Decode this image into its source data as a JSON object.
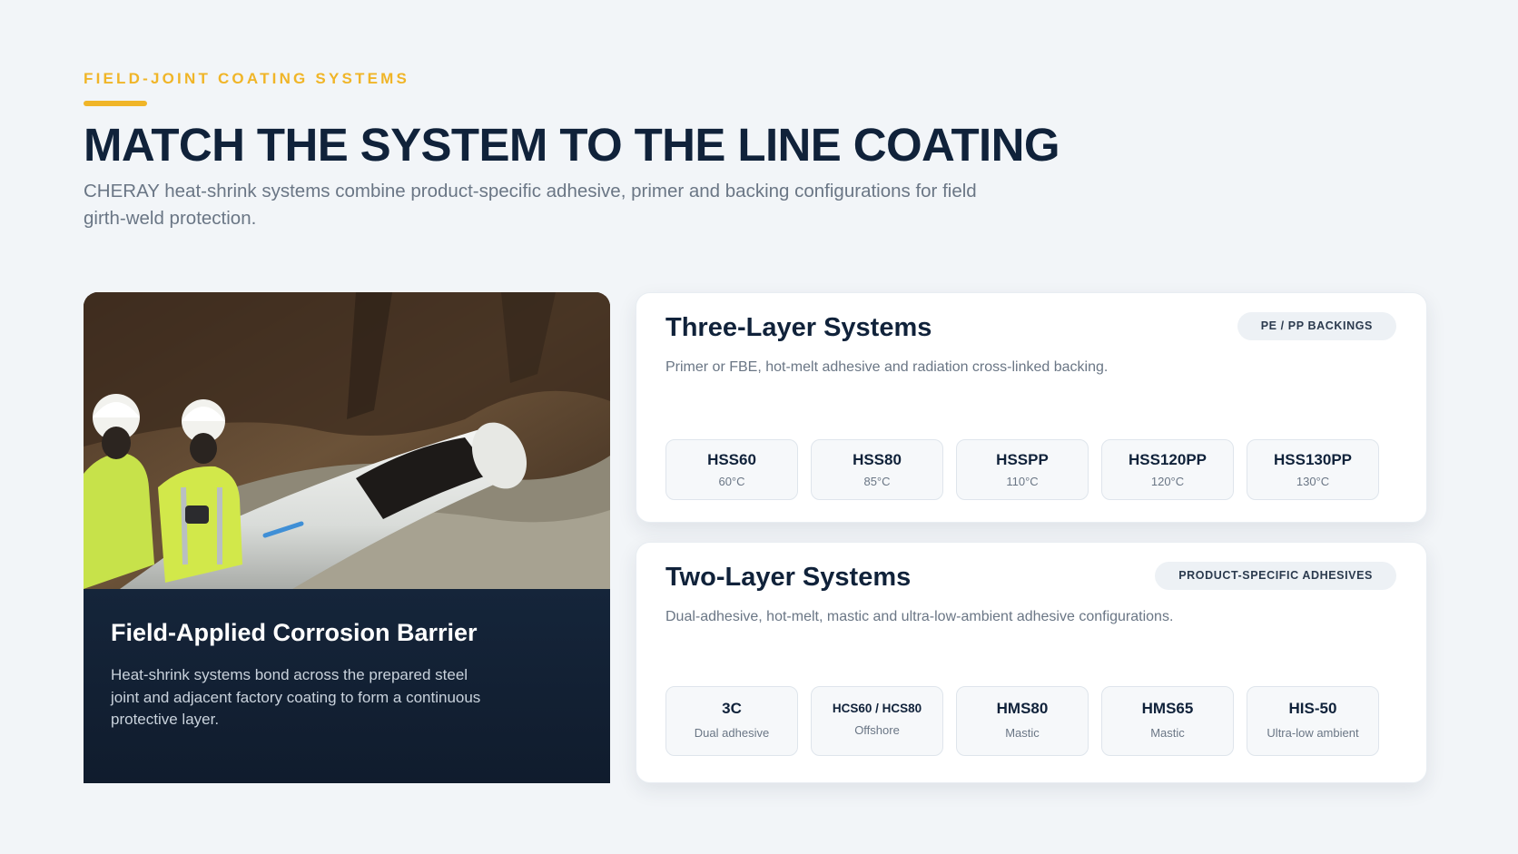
{
  "header": {
    "eyebrow": "FIELD-JOINT COATING SYSTEMS",
    "title": "MATCH THE SYSTEM TO THE LINE COATING",
    "subtitle": "CHERAY heat-shrink systems combine product-specific adhesive, primer and backing configurations for field girth-weld protection."
  },
  "photo_card": {
    "title": "Field-Applied Corrosion Barrier",
    "text": "Heat-shrink systems bond across the prepared steel joint and adjacent factory coating to form a continuous protective layer."
  },
  "three_layer": {
    "title": "Three-Layer Systems",
    "badge": "PE / PP BACKINGS",
    "description": "Primer or FBE, hot-melt adhesive and radiation cross-linked backing.",
    "products": [
      {
        "name": "HSS60",
        "sub": "60°C"
      },
      {
        "name": "HSS80",
        "sub": "85°C"
      },
      {
        "name": "HSSPP",
        "sub": "110°C"
      },
      {
        "name": "HSS120PP",
        "sub": "120°C"
      },
      {
        "name": "HSS130PP",
        "sub": "130°C"
      }
    ]
  },
  "two_layer": {
    "title": "Two-Layer Systems",
    "badge": "PRODUCT-SPECIFIC ADHESIVES",
    "description": "Dual-adhesive, hot-melt, mastic and ultra-low-ambient adhesive configurations.",
    "products": [
      {
        "name": "3C",
        "sub": "Dual adhesive"
      },
      {
        "name": "HCS60 / HCS80",
        "sub": "Offshore"
      },
      {
        "name": "HMS80",
        "sub": "Mastic"
      },
      {
        "name": "HMS65",
        "sub": "Mastic"
      },
      {
        "name": "HIS-50",
        "sub": "Ultra-low ambient"
      }
    ]
  },
  "colors": {
    "accent": "#f0b528",
    "navy": "#10223a",
    "caption_bg": "#15253a",
    "page_bg": "#f2f5f8"
  }
}
